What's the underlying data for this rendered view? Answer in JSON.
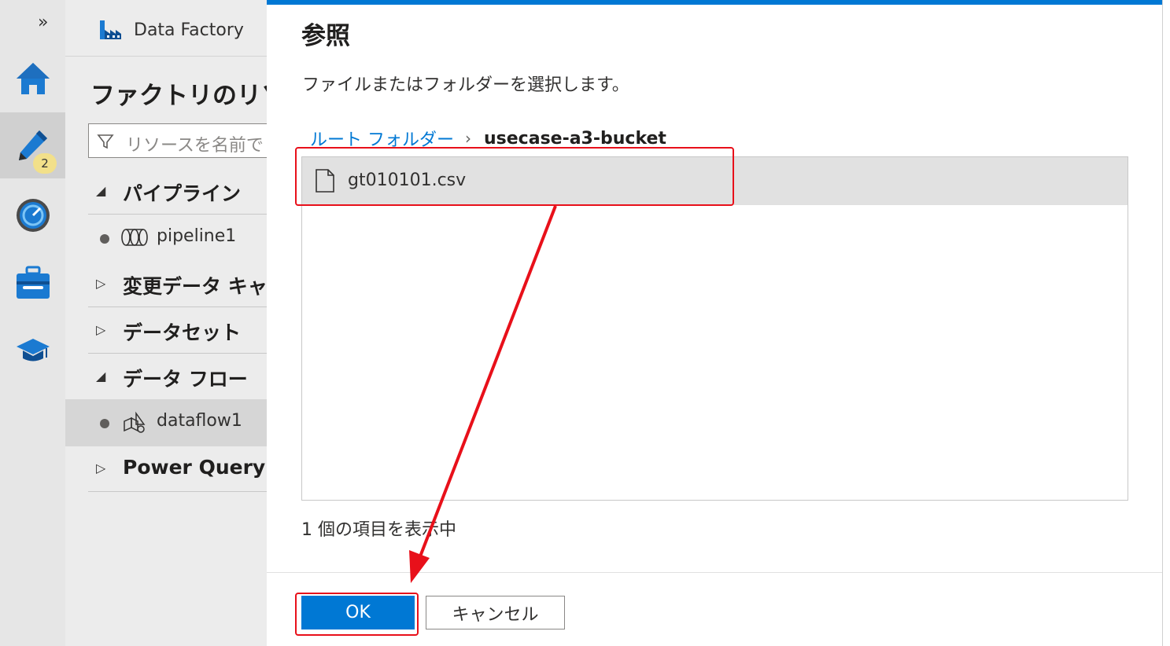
{
  "rail": {
    "expand_glyph": "»",
    "items": [
      {
        "icon": "home-icon"
      },
      {
        "icon": "pencil-icon",
        "badge": "2",
        "active": true
      },
      {
        "icon": "monitor-gauge-icon"
      },
      {
        "icon": "toolbox-icon"
      },
      {
        "icon": "graduation-cap-icon"
      }
    ]
  },
  "panel": {
    "brand": "Data Factory",
    "title": "ファクトリのリソース",
    "search_placeholder": "リソースを名前で",
    "groups": [
      {
        "label": "パイプライン",
        "expanded": true
      },
      {
        "label": "変更データ キャプチャ",
        "expanded": false
      },
      {
        "label": "データセット",
        "expanded": false
      },
      {
        "label": "データ フロー",
        "expanded": true
      },
      {
        "label": "Power Query",
        "expanded": false
      }
    ],
    "pipeline_item": "pipeline1",
    "dataflow_item": "dataflow1",
    "expanded_caret": "◢",
    "collapsed_caret": "▷"
  },
  "dialog": {
    "title": "参照",
    "description": "ファイルまたはフォルダーを選択します。",
    "breadcrumb": {
      "root": "ルート フォルダー",
      "separator": "›",
      "current": "usecase-a3-bucket"
    },
    "files": [
      {
        "name": "gt010101.csv",
        "icon": "file-icon",
        "selected": true
      }
    ],
    "item_count_text": "1 個の項目を表示中",
    "ok_label": "OK",
    "cancel_label": "キャンセル"
  },
  "colors": {
    "accent": "#0078d4",
    "annotation": "#e8101a",
    "selected_row": "#e1e1e1"
  }
}
